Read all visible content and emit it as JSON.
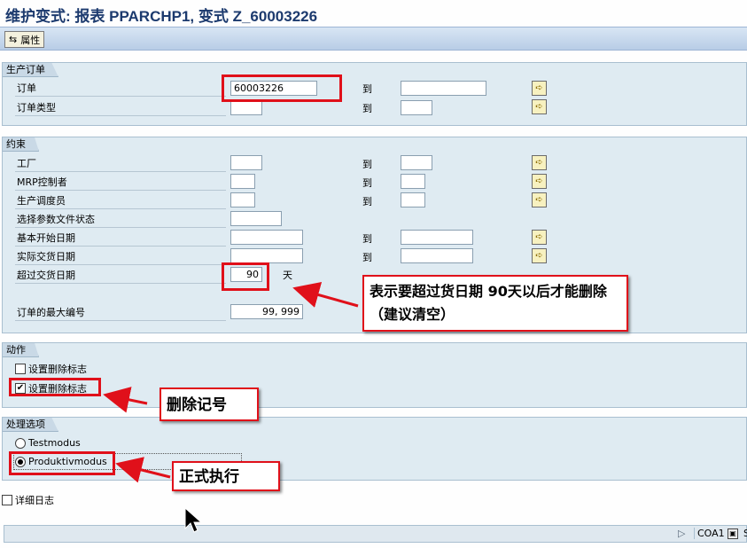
{
  "title": "维护变式: 报表 PPARCHP1, 变式 Z_60003226",
  "toolbar": {
    "attributes_label": "属性",
    "attributes_icon": "attributes-icon"
  },
  "to_label": "到",
  "group_production_order": {
    "title": "生产订单",
    "order_label": "订单",
    "order_from": "60003226",
    "order_to": "",
    "order_type_label": "订单类型",
    "order_type_from": "",
    "order_type_to": ""
  },
  "group_restrictions": {
    "title": "约束",
    "plant_label": "工厂",
    "mrp_label": "MRP控制者",
    "scheduler_label": "生产调度员",
    "profile_status_label": "选择参数文件状态",
    "basic_start_label": "基本开始日期",
    "actual_delivery_label": "实际交货日期",
    "exceed_delivery_label": "超过交货日期",
    "exceed_delivery_value": "90",
    "days_unit": "天",
    "max_orders_label": "订单的最大编号",
    "max_orders_value": "99, 999"
  },
  "group_action": {
    "title": "动作",
    "set_deletion_flag_1": "设置删除标志",
    "set_deletion_flag_2": "设置删除标志",
    "flag_1_checked": false,
    "flag_2_checked": true
  },
  "group_processing": {
    "title": "处理选项",
    "test_mode": "Testmodus",
    "production_mode": "Produktivmodus",
    "selected": "Produktivmodus"
  },
  "detailed_log_label": "详细日志",
  "callouts": {
    "delivery": "表示要超过货日期 90天以后才能删除 （建议清空）",
    "deletion_mark": "删除记号",
    "production_run": "正式执行"
  },
  "statusbar": {
    "system": "COA1",
    "extra": "S"
  },
  "colors": {
    "annotation_red": "#e0101a",
    "title_blue": "#1c3a6e",
    "group_bg": "#dfebf2"
  }
}
